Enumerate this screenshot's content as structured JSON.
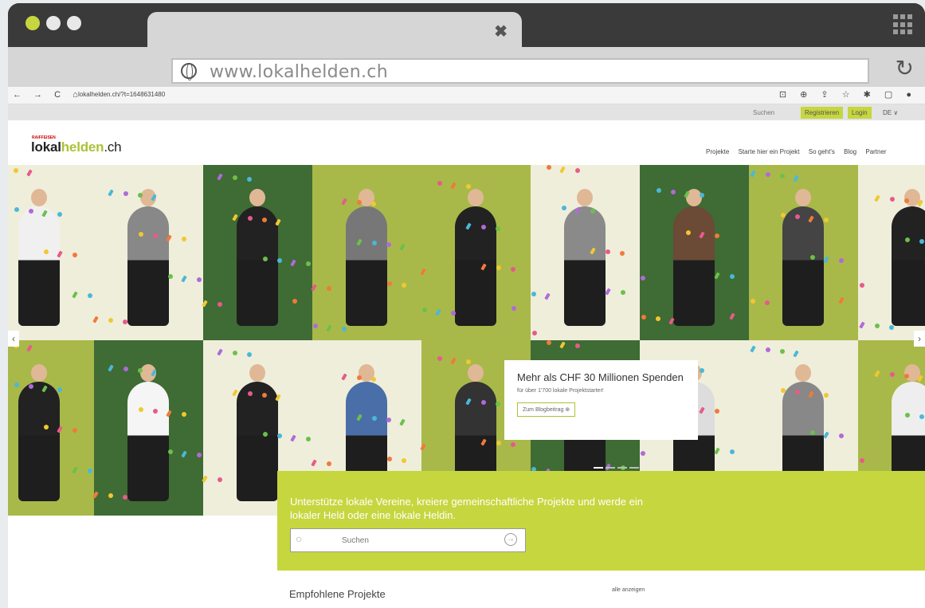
{
  "browser": {
    "tab_close": "✖",
    "url_display": "www.lokalhelden.ch",
    "address": "lokalhelden.ch/?t=1648631480",
    "reload_icon": "↻"
  },
  "site": {
    "topbar": {
      "search_label": "Suchen",
      "register_label": "Registrieren",
      "login_label": "Login",
      "language": "DE ∨"
    },
    "logo": {
      "brand_small": "RAIFFEISEN",
      "part1": "lokal",
      "part2": "helden",
      "part3": ".ch"
    },
    "nav": [
      "Projekte",
      "Starte hier ein Projekt",
      "So geht's",
      "Blog",
      "Partner"
    ],
    "hero": {
      "arrow_left": "‹",
      "arrow_right": "›",
      "promo_title": "Mehr als CHF 30 Millionen Spenden",
      "promo_text": "für über 1'700 lokale Projektstarter!",
      "promo_button": "Zum Blogbeitrag ⊕"
    },
    "search_panel": {
      "claim": "Unterstütze lokale Vereine, kreiere gemeinschaftliche Projekte und werde ein lokaler Held oder eine lokale Heldin.",
      "placeholder": "Suchen",
      "go_icon": "→"
    },
    "recommended": {
      "title": "Empfohlene Projekte",
      "show_all": "alle anzeigen"
    }
  },
  "colors": {
    "accent": "#c6d63f",
    "dark_green": "#3f6b34",
    "olive": "#a8b94a",
    "cream": "#efeedb"
  }
}
